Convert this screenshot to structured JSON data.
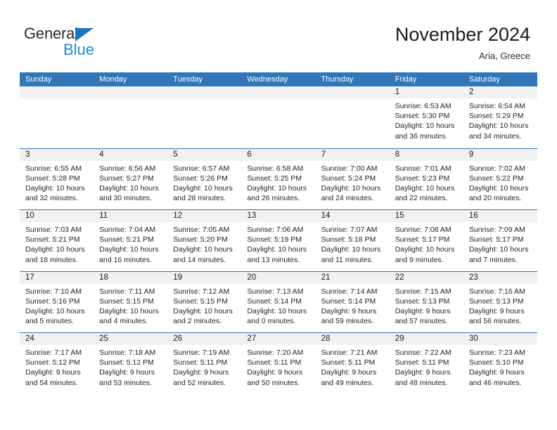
{
  "brand": {
    "name_part1": "General",
    "name_part2": "Blue",
    "accent_blue": "#1b75bc",
    "light_blue": "#1b8ad6"
  },
  "header": {
    "title": "November 2024",
    "subtitle": "Aria, Greece"
  },
  "theme": {
    "header_band": "#3176b8",
    "day_band": "#f1f1f1",
    "separator": "#3176b8",
    "text": "#242424"
  },
  "weekdays": [
    "Sunday",
    "Monday",
    "Tuesday",
    "Wednesday",
    "Thursday",
    "Friday",
    "Saturday"
  ],
  "weeks": [
    [
      {
        "day": "",
        "empty": true
      },
      {
        "day": "",
        "empty": true
      },
      {
        "day": "",
        "empty": true
      },
      {
        "day": "",
        "empty": true
      },
      {
        "day": "",
        "empty": true
      },
      {
        "day": "1",
        "sunrise": "Sunrise: 6:53 AM",
        "sunset": "Sunset: 5:30 PM",
        "daylight1": "Daylight: 10 hours",
        "daylight2": "and 36 minutes."
      },
      {
        "day": "2",
        "sunrise": "Sunrise: 6:54 AM",
        "sunset": "Sunset: 5:29 PM",
        "daylight1": "Daylight: 10 hours",
        "daylight2": "and 34 minutes."
      }
    ],
    [
      {
        "day": "3",
        "sunrise": "Sunrise: 6:55 AM",
        "sunset": "Sunset: 5:28 PM",
        "daylight1": "Daylight: 10 hours",
        "daylight2": "and 32 minutes."
      },
      {
        "day": "4",
        "sunrise": "Sunrise: 6:56 AM",
        "sunset": "Sunset: 5:27 PM",
        "daylight1": "Daylight: 10 hours",
        "daylight2": "and 30 minutes."
      },
      {
        "day": "5",
        "sunrise": "Sunrise: 6:57 AM",
        "sunset": "Sunset: 5:26 PM",
        "daylight1": "Daylight: 10 hours",
        "daylight2": "and 28 minutes."
      },
      {
        "day": "6",
        "sunrise": "Sunrise: 6:58 AM",
        "sunset": "Sunset: 5:25 PM",
        "daylight1": "Daylight: 10 hours",
        "daylight2": "and 26 minutes."
      },
      {
        "day": "7",
        "sunrise": "Sunrise: 7:00 AM",
        "sunset": "Sunset: 5:24 PM",
        "daylight1": "Daylight: 10 hours",
        "daylight2": "and 24 minutes."
      },
      {
        "day": "8",
        "sunrise": "Sunrise: 7:01 AM",
        "sunset": "Sunset: 5:23 PM",
        "daylight1": "Daylight: 10 hours",
        "daylight2": "and 22 minutes."
      },
      {
        "day": "9",
        "sunrise": "Sunrise: 7:02 AM",
        "sunset": "Sunset: 5:22 PM",
        "daylight1": "Daylight: 10 hours",
        "daylight2": "and 20 minutes."
      }
    ],
    [
      {
        "day": "10",
        "sunrise": "Sunrise: 7:03 AM",
        "sunset": "Sunset: 5:21 PM",
        "daylight1": "Daylight: 10 hours",
        "daylight2": "and 18 minutes."
      },
      {
        "day": "11",
        "sunrise": "Sunrise: 7:04 AM",
        "sunset": "Sunset: 5:21 PM",
        "daylight1": "Daylight: 10 hours",
        "daylight2": "and 16 minutes."
      },
      {
        "day": "12",
        "sunrise": "Sunrise: 7:05 AM",
        "sunset": "Sunset: 5:20 PM",
        "daylight1": "Daylight: 10 hours",
        "daylight2": "and 14 minutes."
      },
      {
        "day": "13",
        "sunrise": "Sunrise: 7:06 AM",
        "sunset": "Sunset: 5:19 PM",
        "daylight1": "Daylight: 10 hours",
        "daylight2": "and 13 minutes."
      },
      {
        "day": "14",
        "sunrise": "Sunrise: 7:07 AM",
        "sunset": "Sunset: 5:18 PM",
        "daylight1": "Daylight: 10 hours",
        "daylight2": "and 11 minutes."
      },
      {
        "day": "15",
        "sunrise": "Sunrise: 7:08 AM",
        "sunset": "Sunset: 5:17 PM",
        "daylight1": "Daylight: 10 hours",
        "daylight2": "and 9 minutes."
      },
      {
        "day": "16",
        "sunrise": "Sunrise: 7:09 AM",
        "sunset": "Sunset: 5:17 PM",
        "daylight1": "Daylight: 10 hours",
        "daylight2": "and 7 minutes."
      }
    ],
    [
      {
        "day": "17",
        "sunrise": "Sunrise: 7:10 AM",
        "sunset": "Sunset: 5:16 PM",
        "daylight1": "Daylight: 10 hours",
        "daylight2": "and 5 minutes."
      },
      {
        "day": "18",
        "sunrise": "Sunrise: 7:11 AM",
        "sunset": "Sunset: 5:15 PM",
        "daylight1": "Daylight: 10 hours",
        "daylight2": "and 4 minutes."
      },
      {
        "day": "19",
        "sunrise": "Sunrise: 7:12 AM",
        "sunset": "Sunset: 5:15 PM",
        "daylight1": "Daylight: 10 hours",
        "daylight2": "and 2 minutes."
      },
      {
        "day": "20",
        "sunrise": "Sunrise: 7:13 AM",
        "sunset": "Sunset: 5:14 PM",
        "daylight1": "Daylight: 10 hours",
        "daylight2": "and 0 minutes."
      },
      {
        "day": "21",
        "sunrise": "Sunrise: 7:14 AM",
        "sunset": "Sunset: 5:14 PM",
        "daylight1": "Daylight: 9 hours",
        "daylight2": "and 59 minutes."
      },
      {
        "day": "22",
        "sunrise": "Sunrise: 7:15 AM",
        "sunset": "Sunset: 5:13 PM",
        "daylight1": "Daylight: 9 hours",
        "daylight2": "and 57 minutes."
      },
      {
        "day": "23",
        "sunrise": "Sunrise: 7:16 AM",
        "sunset": "Sunset: 5:13 PM",
        "daylight1": "Daylight: 9 hours",
        "daylight2": "and 56 minutes."
      }
    ],
    [
      {
        "day": "24",
        "sunrise": "Sunrise: 7:17 AM",
        "sunset": "Sunset: 5:12 PM",
        "daylight1": "Daylight: 9 hours",
        "daylight2": "and 54 minutes."
      },
      {
        "day": "25",
        "sunrise": "Sunrise: 7:18 AM",
        "sunset": "Sunset: 5:12 PM",
        "daylight1": "Daylight: 9 hours",
        "daylight2": "and 53 minutes."
      },
      {
        "day": "26",
        "sunrise": "Sunrise: 7:19 AM",
        "sunset": "Sunset: 5:11 PM",
        "daylight1": "Daylight: 9 hours",
        "daylight2": "and 52 minutes."
      },
      {
        "day": "27",
        "sunrise": "Sunrise: 7:20 AM",
        "sunset": "Sunset: 5:11 PM",
        "daylight1": "Daylight: 9 hours",
        "daylight2": "and 50 minutes."
      },
      {
        "day": "28",
        "sunrise": "Sunrise: 7:21 AM",
        "sunset": "Sunset: 5:11 PM",
        "daylight1": "Daylight: 9 hours",
        "daylight2": "and 49 minutes."
      },
      {
        "day": "29",
        "sunrise": "Sunrise: 7:22 AM",
        "sunset": "Sunset: 5:11 PM",
        "daylight1": "Daylight: 9 hours",
        "daylight2": "and 48 minutes."
      },
      {
        "day": "30",
        "sunrise": "Sunrise: 7:23 AM",
        "sunset": "Sunset: 5:10 PM",
        "daylight1": "Daylight: 9 hours",
        "daylight2": "and 46 minutes."
      }
    ]
  ]
}
